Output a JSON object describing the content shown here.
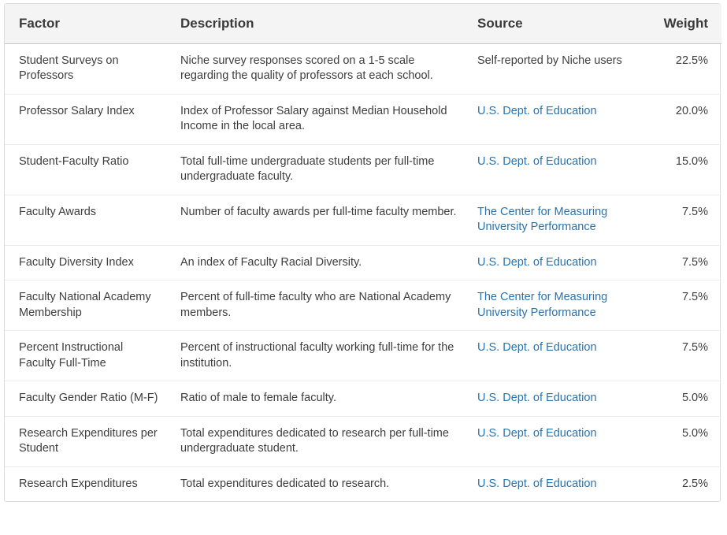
{
  "table": {
    "headers": {
      "factor": "Factor",
      "description": "Description",
      "source": "Source",
      "weight": "Weight"
    },
    "rows": [
      {
        "factor": "Student Surveys on Professors",
        "description": "Niche survey responses scored on a 1-5 scale regarding the quality of professors at each school.",
        "source": "Self-reported by Niche users",
        "source_is_link": false,
        "weight": "22.5%"
      },
      {
        "factor": "Professor Salary Index",
        "description": "Index of Professor Salary against Median Household Income in the local area.",
        "source": "U.S. Dept. of Education",
        "source_is_link": true,
        "weight": "20.0%"
      },
      {
        "factor": "Student-Faculty Ratio",
        "description": "Total full-time undergraduate students per full-time undergraduate faculty.",
        "source": "U.S. Dept. of Education",
        "source_is_link": true,
        "weight": "15.0%"
      },
      {
        "factor": "Faculty Awards",
        "description": "Number of faculty awards per full-time faculty member.",
        "source": "The Center for Measuring University Performance",
        "source_is_link": true,
        "weight": "7.5%"
      },
      {
        "factor": "Faculty Diversity Index",
        "description": "An index of Faculty Racial Diversity.",
        "source": "U.S. Dept. of Education",
        "source_is_link": true,
        "weight": "7.5%"
      },
      {
        "factor": "Faculty National Academy Membership",
        "description": "Percent of full-time faculty who are National Academy members.",
        "source": "The Center for Measuring University Performance",
        "source_is_link": true,
        "weight": "7.5%"
      },
      {
        "factor": "Percent Instructional Faculty Full-Time",
        "description": "Percent of instructional faculty working full-time for the institution.",
        "source": "U.S. Dept. of Education",
        "source_is_link": true,
        "weight": "7.5%"
      },
      {
        "factor": "Faculty Gender Ratio (M-F)",
        "description": "Ratio of male to female faculty.",
        "source": "U.S. Dept. of Education",
        "source_is_link": true,
        "weight": "5.0%"
      },
      {
        "factor": "Research Expenditures per Student",
        "description": "Total expenditures dedicated to research per full-time undergraduate student.",
        "source": "U.S. Dept. of Education",
        "source_is_link": true,
        "weight": "5.0%"
      },
      {
        "factor": "Research Expenditures",
        "description": "Total expenditures dedicated to research.",
        "source": "U.S. Dept. of Education",
        "source_is_link": true,
        "weight": "2.5%"
      }
    ],
    "colors": {
      "link": "#2a73ad",
      "text": "#3d3d3d",
      "header_bg": "#f4f4f4"
    }
  }
}
